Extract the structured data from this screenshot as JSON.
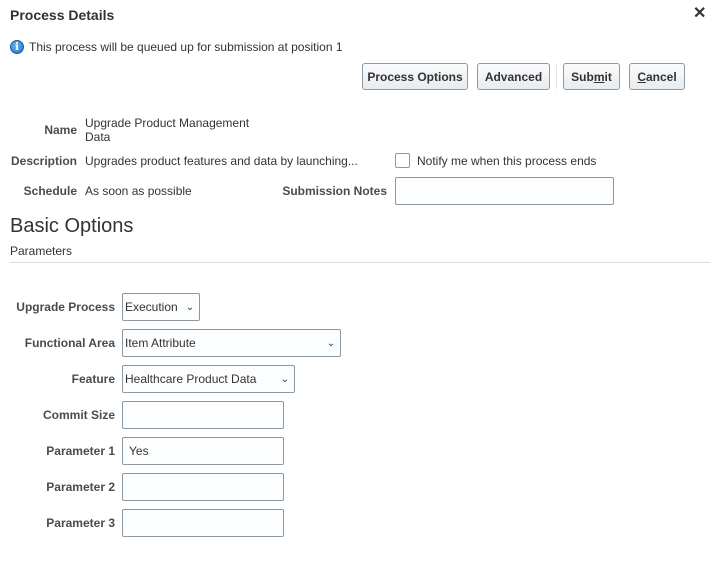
{
  "dialog": {
    "title": "Process Details",
    "close_icon": "close-icon",
    "info_icon": "info-icon",
    "info_message": "This process will be queued up for submission at position 1"
  },
  "toolbar": {
    "process_options_label": "Process Options",
    "advanced_label": "Advanced",
    "submit_label": "Submit",
    "submit_mnemonic": "m",
    "cancel_label": "Cancel",
    "cancel_mnemonic": "C"
  },
  "details": {
    "name_label": "Name",
    "name_value_line1": "Upgrade Product Management",
    "name_value_line2": "Data",
    "description_label": "Description",
    "description_value": "Upgrades product features and data by launching...",
    "schedule_label": "Schedule",
    "schedule_value": "As soon as possible",
    "notify_label": "Notify me when this process ends",
    "notify_checked": false,
    "submission_notes_label": "Submission Notes",
    "submission_notes_value": ""
  },
  "basic_options": {
    "title": "Basic Options",
    "subtitle": "Parameters",
    "fields": {
      "upgrade_process": {
        "label": "Upgrade Process",
        "value": "Execution"
      },
      "functional_area": {
        "label": "Functional Area",
        "value": "Item Attribute"
      },
      "feature": {
        "label": "Feature",
        "value": "Healthcare Product Data"
      },
      "commit_size": {
        "label": "Commit Size",
        "value": ""
      },
      "parameter1": {
        "label": "Parameter 1",
        "value": "Yes"
      },
      "parameter2": {
        "label": "Parameter 2",
        "value": ""
      },
      "parameter3": {
        "label": "Parameter 3",
        "value": ""
      }
    }
  }
}
